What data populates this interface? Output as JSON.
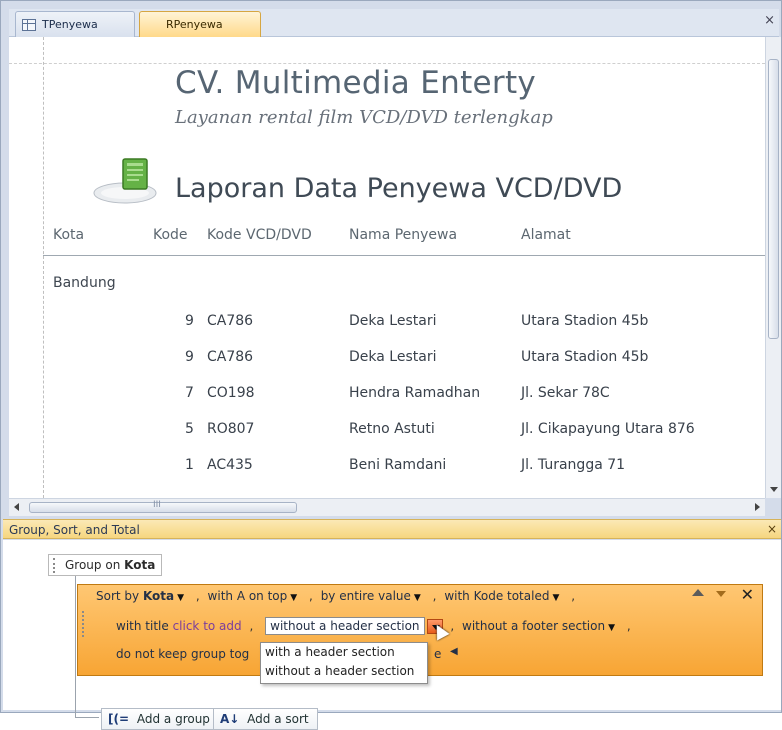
{
  "tabs": [
    {
      "label": "TPenyewa",
      "icon": "table-icon",
      "active": false
    },
    {
      "label": "RPenyewa",
      "icon": "report-icon",
      "active": true
    }
  ],
  "close_symbol": "×",
  "report": {
    "company": "CV. Multimedia Enterty",
    "tagline": "Layanan rental film VCD/DVD terlengkap",
    "title": "Laporan Data Penyewa VCD/DVD",
    "columns": [
      "Kota",
      "Kode",
      "Kode VCD/DVD",
      "Nama Penyewa",
      "Alamat"
    ],
    "group": "Bandung",
    "rows": [
      {
        "kode": "9",
        "vcd": "CA786",
        "nama": "Deka Lestari",
        "alamat": "Utara Stadion 45b"
      },
      {
        "kode": "9",
        "vcd": "CA786",
        "nama": "Deka Lestari",
        "alamat": "Utara Stadion 45b"
      },
      {
        "kode": "7",
        "vcd": "CO198",
        "nama": "Hendra Ramadhan",
        "alamat": "Jl. Sekar 78C"
      },
      {
        "kode": "5",
        "vcd": "RO807",
        "nama": "Retno Astuti",
        "alamat": "Jl. Cikapayung Utara 876"
      },
      {
        "kode": "1",
        "vcd": "AC435",
        "nama": "Beni Ramdani",
        "alamat": "Jl. Turangga 71"
      }
    ]
  },
  "hscroll_grip": "III",
  "gst": {
    "title": "Group, Sort, and Total",
    "group_on_label": "Group on",
    "group_on_field": "Kota",
    "sort_by_label": "Sort by",
    "sort_field": "Kota",
    "with_a_on_top": "with A on top",
    "by_entire_value": "by entire value",
    "with_kode_totaled": "with Kode totaled",
    "with_title": "with title",
    "click_to_add": "click to add",
    "header_section_value": "without a header section",
    "without_footer": "without a footer section",
    "do_not_keep": "do not keep group tog",
    "hidden_tail": "e",
    "dropdown_options": [
      "with a header section",
      "without a header section"
    ],
    "add_group": "Add a group",
    "add_sort": "Add a sort",
    "add_group_icon_text": "[(=",
    "add_sort_icon_text": "A↓"
  }
}
